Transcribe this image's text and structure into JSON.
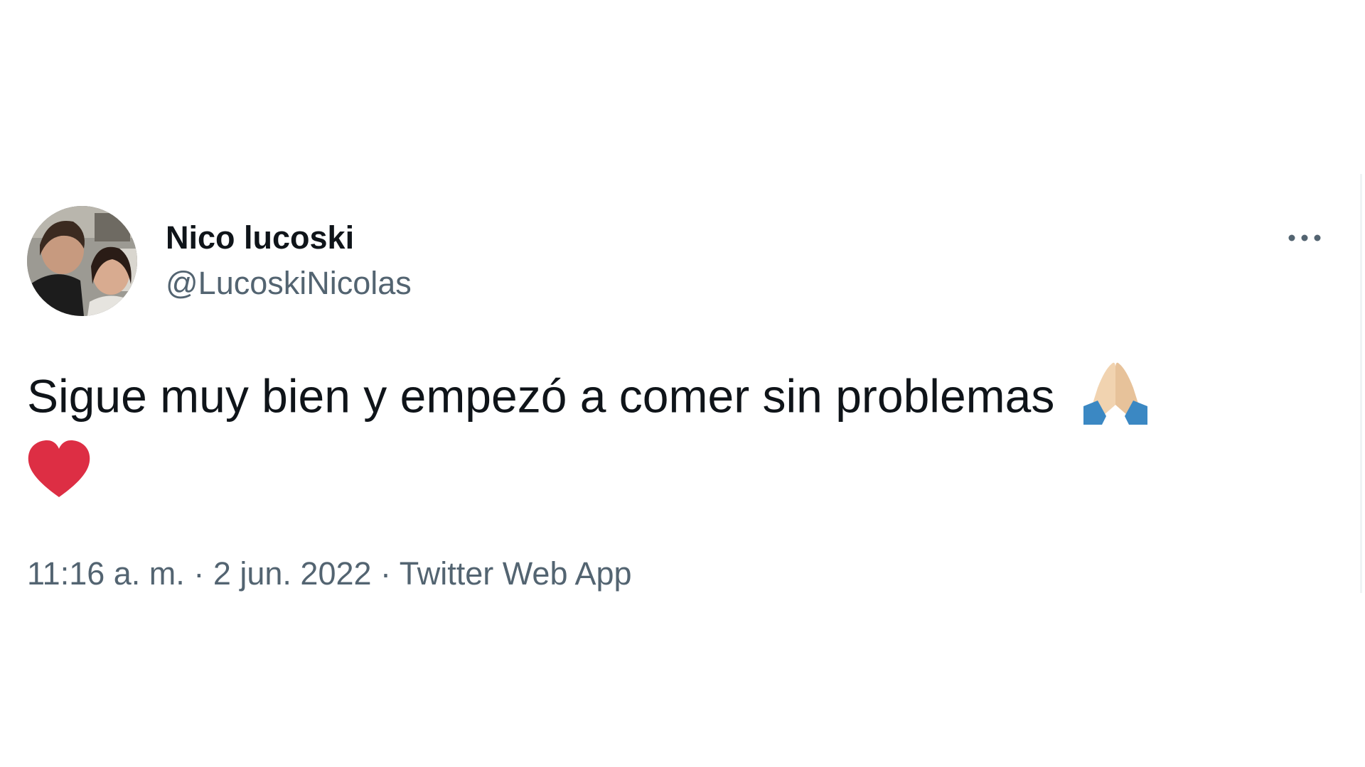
{
  "tweet": {
    "display_name": "Nico lucoski",
    "handle": "@LucoskiNicolas",
    "text": "Sigue muy bien y empezó a comer sin problemas",
    "emojis": [
      "folded-hands-icon",
      "red-heart-icon"
    ],
    "time": "11:16 a. m.",
    "separator": "·",
    "date": "2 jun. 2022",
    "source": "Twitter Web App"
  },
  "colors": {
    "primary_text": "#0f1419",
    "secondary_text": "#536471",
    "heart": "#dd2e44",
    "background": "#ffffff"
  }
}
